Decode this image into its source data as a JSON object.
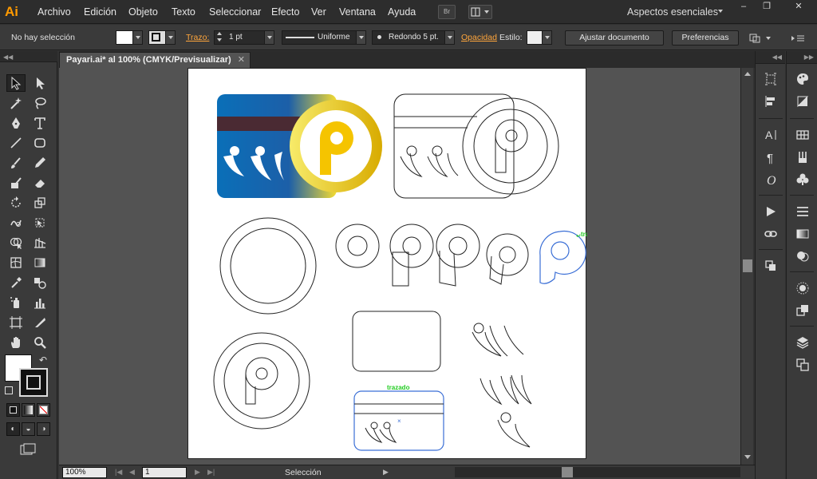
{
  "app": {
    "logo_text": "Ai"
  },
  "menu": [
    "Archivo",
    "Edición",
    "Objeto",
    "Texto",
    "Seleccionar",
    "Efecto",
    "Ver",
    "Ventana",
    "Ayuda"
  ],
  "bridge_label": "Br",
  "workspace": "Aspectos esenciales",
  "window_controls": [
    "–",
    "❐",
    "✕"
  ],
  "control": {
    "selection": "No hay selección",
    "stroke_label": "Trazo:",
    "stroke_weight": "1 pt",
    "stroke_profile": "Uniforme",
    "brush": "Redondo 5 pt.",
    "opacity_label": "Opacidad",
    "style_label": "Estilo:",
    "doc_setup": "Ajustar documento",
    "preferences": "Preferencias"
  },
  "document": {
    "tab_title": "Payari.ai* al 100% (CMYK/Previsualizar)",
    "tab_close": "✕"
  },
  "status": {
    "zoom": "100%",
    "page": "1",
    "mode": "Selección"
  },
  "art": {
    "hint_1": "trazado",
    "hint_2": "trazado",
    "card_blue": "#0a6fb8",
    "card_stripe": "#4a2a33",
    "gold": "#f5c400",
    "selection_blue": "#3b6fd6",
    "hint_green": "#22cc22"
  }
}
